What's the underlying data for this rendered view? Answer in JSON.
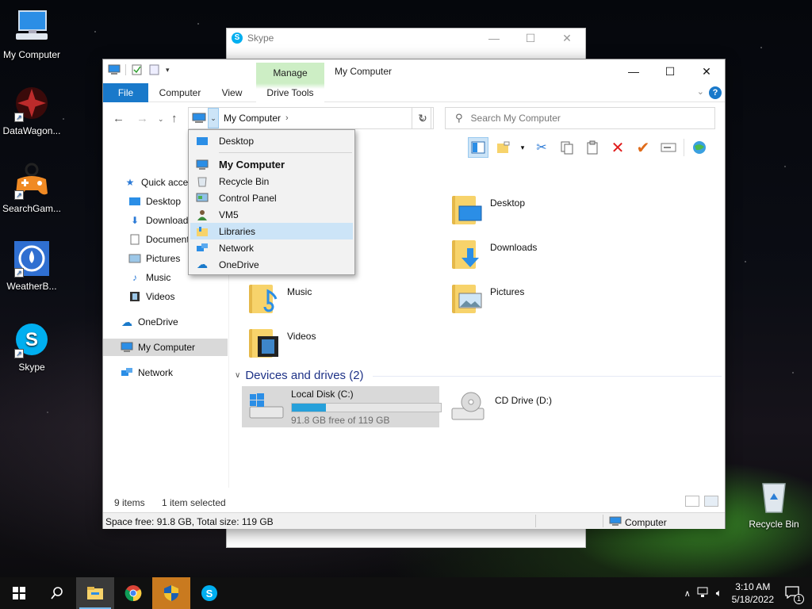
{
  "desktop": {
    "icons": [
      {
        "label": "My Computer"
      },
      {
        "label": "DataWagon..."
      },
      {
        "label": "SearchGam..."
      },
      {
        "label": "WeatherB..."
      },
      {
        "label": "Skype"
      },
      {
        "label": "Recycle Bin"
      }
    ]
  },
  "skype_window": {
    "title": "Skype"
  },
  "explorer": {
    "title": "My Computer",
    "ribbon": {
      "file": "File",
      "computer": "Computer",
      "view": "View",
      "manage": "Manage",
      "drive_tools": "Drive Tools",
      "help": "?"
    },
    "address": {
      "path": "My Computer"
    },
    "search": {
      "placeholder": "Search My Computer"
    },
    "sidebar": {
      "items": [
        {
          "label": "Quick access"
        },
        {
          "label": "Desktop"
        },
        {
          "label": "Downloads"
        },
        {
          "label": "Documents"
        },
        {
          "label": "Pictures"
        },
        {
          "label": "Music"
        },
        {
          "label": "Videos"
        },
        {
          "label": "OneDrive"
        },
        {
          "label": "My Computer"
        },
        {
          "label": "Network"
        }
      ]
    },
    "folders": [
      {
        "label": "Desktop"
      },
      {
        "label": "Downloads"
      },
      {
        "label": "Music"
      },
      {
        "label": "Pictures"
      },
      {
        "label": "Videos"
      }
    ],
    "devices_header": "Devices and drives (2)",
    "drives": [
      {
        "name": "Local Disk (C:)",
        "free_text": "91.8 GB free of 119 GB",
        "used_fraction": 0.23
      },
      {
        "name": "CD Drive (D:)"
      }
    ],
    "status": {
      "items": "9 items",
      "selected": "1 item selected"
    },
    "bottom": {
      "space": "Space free: 91.8 GB, Total size: 119 GB",
      "location": "Computer"
    }
  },
  "address_dropdown": {
    "items": [
      {
        "label": "Desktop"
      },
      {
        "label": "My Computer"
      },
      {
        "label": "Recycle Bin"
      },
      {
        "label": "Control Panel"
      },
      {
        "label": "VM5"
      },
      {
        "label": "Libraries"
      },
      {
        "label": "Network"
      },
      {
        "label": "OneDrive"
      }
    ]
  },
  "taskbar": {
    "time": "3:10 AM",
    "date": "5/18/2022",
    "notification_count": "1"
  },
  "colors": {
    "accent": "#1979ca",
    "selection": "#cce4f7",
    "manage_tab": "#cdeec5"
  }
}
